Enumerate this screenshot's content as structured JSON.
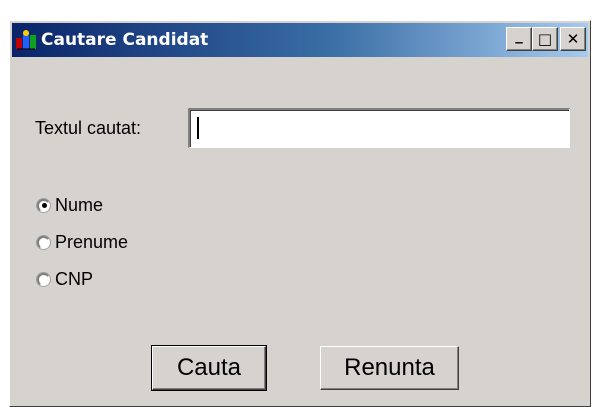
{
  "window": {
    "title": "Cautare Candidat",
    "controls": {
      "minimize_glyph": "_",
      "maximize_glyph": "□",
      "close_glyph": "✕"
    },
    "icon": "app-logo-icon"
  },
  "form": {
    "search_label": "Textul cautat:",
    "search_value": "",
    "search_options": [
      {
        "label": "Nume",
        "selected": true
      },
      {
        "label": "Prenume",
        "selected": false
      },
      {
        "label": "CNP",
        "selected": false
      }
    ]
  },
  "buttons": {
    "search_label": "Cauta",
    "cancel_label": "Renunta"
  },
  "colors": {
    "title_gradient_start": "#0a246a",
    "title_gradient_end": "#a6caf0",
    "face": "#d6d3ce"
  }
}
